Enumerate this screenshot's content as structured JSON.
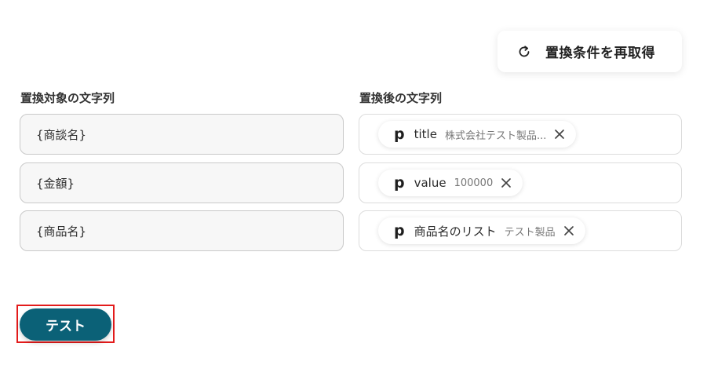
{
  "toolbar": {
    "refetch_label": "置換条件を再取得",
    "refetch_icon": "refresh-icon"
  },
  "columns": {
    "source_label": "置換対象の文字列",
    "target_label": "置換後の文字列"
  },
  "rows": [
    {
      "source": "{商談名}",
      "target": {
        "icon": "p",
        "name": "title",
        "value": "株式会社テスト製品..."
      }
    },
    {
      "source": "{金額}",
      "target": {
        "icon": "p",
        "name": "value",
        "value": "100000"
      }
    },
    {
      "source": "{商品名}",
      "target": {
        "icon": "p",
        "name": "商品名のリスト",
        "value": "テスト製品"
      }
    }
  ],
  "footer": {
    "test_label": "テスト"
  },
  "colors": {
    "primary": "#0b6177",
    "highlight": "#e31b1b"
  }
}
